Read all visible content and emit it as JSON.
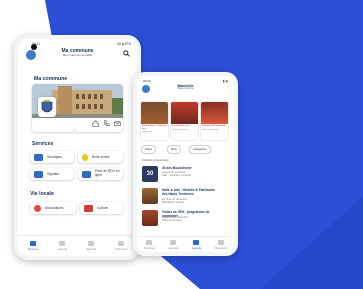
{
  "colors": {
    "background_blue": "#2d4fd6",
    "accent": "#2e6bc2",
    "title": "#1b2f56"
  },
  "phone1": {
    "status": {
      "time": "09:41",
      "icons": "4G ▮ 87%"
    },
    "header": {
      "title": "Ma commune",
      "subtitle": "Mon intercommunalité",
      "search_icon": "search-icon"
    },
    "section_title": "Ma commune",
    "services_title": "Services",
    "services": [
      {
        "label": "Sondages",
        "icon": "chat-icon",
        "color": "#2e6bc2"
      },
      {
        "label": "Boîte à idée",
        "icon": "lightbulb-icon",
        "color": "#f0f0f0"
      },
      {
        "label": "Signaler",
        "icon": "alert-icon",
        "color": "#2e6bc2"
      },
      {
        "label": "Prise de RDV en ligne",
        "icon": "calendar-icon",
        "color": "#2e6bc2"
      }
    ],
    "vie_locale_title": "Vie locale",
    "vie_locale": [
      {
        "label": "Associations",
        "icon": "associations-icon"
      },
      {
        "label": "Culture",
        "icon": "culture-icon"
      }
    ],
    "tabs": [
      {
        "label": "Services",
        "icon": "home-icon"
      },
      {
        "label": "Journal",
        "icon": "newspaper-icon"
      },
      {
        "label": "Agenda",
        "icon": "calendar-icon"
      },
      {
        "label": "Découvrir",
        "icon": "compass-icon"
      }
    ]
  },
  "phone2": {
    "status": {
      "time": "09:02",
      "icons": "▮ ◉"
    },
    "header": {
      "title": "Marseille",
      "subtitle": "Haute Garonne"
    },
    "carousel": [
      {
        "title": "Salle & Jeux — Pole du feu",
        "caption": "Évènement"
      },
      {
        "title": "Festival des arts",
        "caption": "Office du Tourisme"
      },
      {
        "title": "Journée du Patrimoine",
        "caption": "Office du Tourisme"
      }
    ],
    "filters": [
      "Dates",
      "Mois",
      "Catégories"
    ],
    "list_heading": "Prochains événements",
    "events": [
      {
        "title": "30 ans Boulodrome",
        "date": "Samedi 16 septembre",
        "place": "Salle · Complexe municipal"
      },
      {
        "title": "Halle & Arts : Histoire & Patrimoine des Hauts Territoires",
        "date": "Du 15 au 17 septembre",
        "place": "Bibliothèque centrale"
      },
      {
        "title": "Visites de l'Été : programme de septembre",
        "date": "Dimanche 24 septembre",
        "place": "Office de Tourisme"
      }
    ],
    "tabs": [
      {
        "label": "Services",
        "icon": "home-icon"
      },
      {
        "label": "Journal",
        "icon": "newspaper-icon"
      },
      {
        "label": "Agenda",
        "icon": "calendar-icon"
      },
      {
        "label": "Découvrir",
        "icon": "compass-icon"
      }
    ]
  }
}
